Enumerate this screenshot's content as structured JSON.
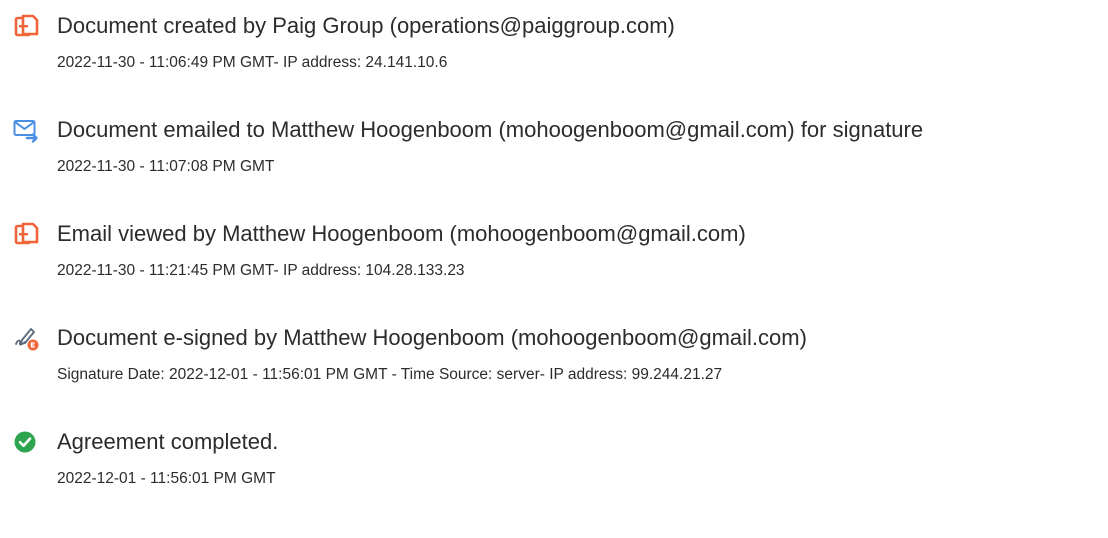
{
  "events": [
    {
      "icon": "document-created-icon",
      "title": "Document created by Paig Group (operations@paiggroup.com)",
      "detail": "2022-11-30 - 11:06:49 PM GMT- IP address: 24.141.10.6"
    },
    {
      "icon": "email-sent-icon",
      "title": "Document emailed to Matthew Hoogenboom (mohoogenboom@gmail.com) for signature",
      "detail": "2022-11-30 - 11:07:08 PM GMT"
    },
    {
      "icon": "email-viewed-icon",
      "title": "Email viewed by Matthew Hoogenboom (mohoogenboom@gmail.com)",
      "detail": "2022-11-30 - 11:21:45 PM GMT- IP address: 104.28.133.23"
    },
    {
      "icon": "e-sign-pen-icon",
      "title": "Document e-signed by Matthew Hoogenboom (mohoogenboom@gmail.com)",
      "detail": "Signature Date: 2022-12-01 - 11:56:01 PM GMT - Time Source: server- IP address: 99.244.21.27"
    },
    {
      "icon": "check-circle-icon",
      "title": "Agreement completed.",
      "detail": "2022-12-01 - 11:56:01 PM GMT"
    }
  ],
  "colors": {
    "document_icon": "#f0643a",
    "email_icon": "#4a90e2",
    "esign_pen": "#5a6b7a",
    "esign_badge": "#f0643a",
    "check_icon": "#2da44e",
    "text": "#2c2c2c"
  }
}
